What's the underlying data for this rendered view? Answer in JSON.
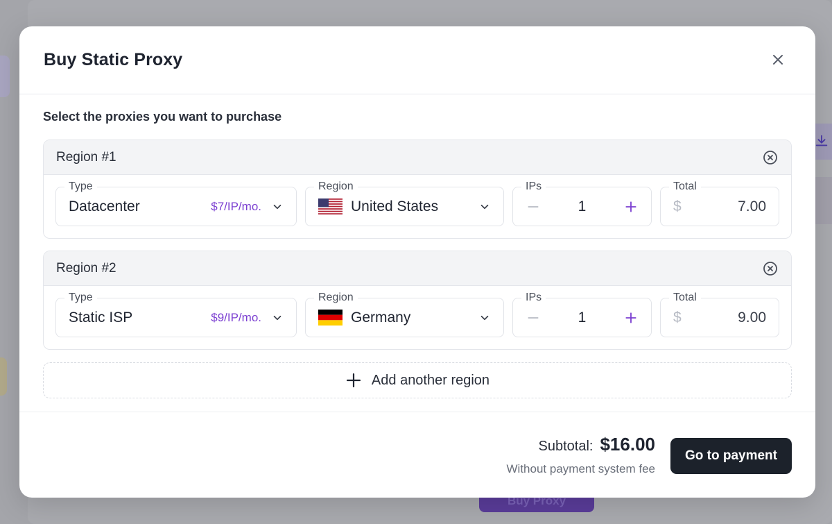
{
  "background": {
    "buy_button_label": "Buy Proxy"
  },
  "modal": {
    "title": "Buy Static Proxy",
    "subtitle": "Select the proxies you want to purchase",
    "close_icon": "close-icon"
  },
  "labels": {
    "type": "Type",
    "region": "Region",
    "ips": "IPs",
    "total": "Total",
    "currency": "$"
  },
  "regions": [
    {
      "name": "Region #1",
      "type": "Datacenter",
      "price": "$7/IP/mo.",
      "country": "United States",
      "flag": "us-flag",
      "ips": "1",
      "total": "7.00"
    },
    {
      "name": "Region #2",
      "type": "Static ISP",
      "price": "$9/IP/mo.",
      "country": "Germany",
      "flag": "de-flag",
      "ips": "1",
      "total": "9.00"
    }
  ],
  "add_region_label": "Add another region",
  "footer": {
    "subtotal_label": "Subtotal:",
    "subtotal_value": "$16.00",
    "note": "Without payment system fee",
    "pay_button": "Go to payment"
  },
  "colors": {
    "accent": "#7b3fd1",
    "primary_button": "#1c222b",
    "overlay": "#9a9ba0"
  }
}
